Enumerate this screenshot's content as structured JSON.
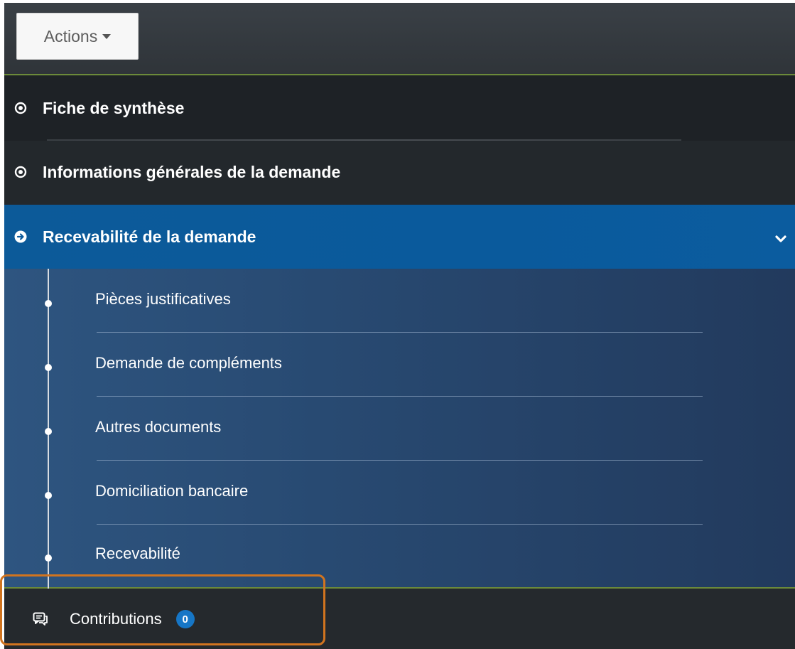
{
  "colors": {
    "topbar_bg": "#353b40",
    "menu_bg": "#23282d",
    "active_bg": "#0b5a9c",
    "submenu_bg": "#2a4d76",
    "accent_line": "#6c8a3a",
    "badge_bg": "#1676c6",
    "highlight_border": "#d1741f"
  },
  "toolbar": {
    "actions_label": "Actions",
    "actions_icon": "caret-down-icon"
  },
  "menu": {
    "items": [
      {
        "label": "Fiche de synthèse",
        "icon": "circle-dot-icon"
      },
      {
        "label": "Informations générales de la demande",
        "icon": "circle-dot-icon"
      },
      {
        "label": "Recevabilité de la demande",
        "icon": "arrow-circle-right-icon",
        "expanded": true,
        "chevron": "chevron-down-icon"
      }
    ]
  },
  "submenu": {
    "items": [
      {
        "label": "Pièces justificatives"
      },
      {
        "label": "Demande de compléments"
      },
      {
        "label": "Autres documents"
      },
      {
        "label": "Domiciliation bancaire"
      },
      {
        "label": "Recevabilité"
      }
    ]
  },
  "contributions": {
    "label": "Contributions",
    "icon": "comments-icon",
    "count": "0"
  }
}
